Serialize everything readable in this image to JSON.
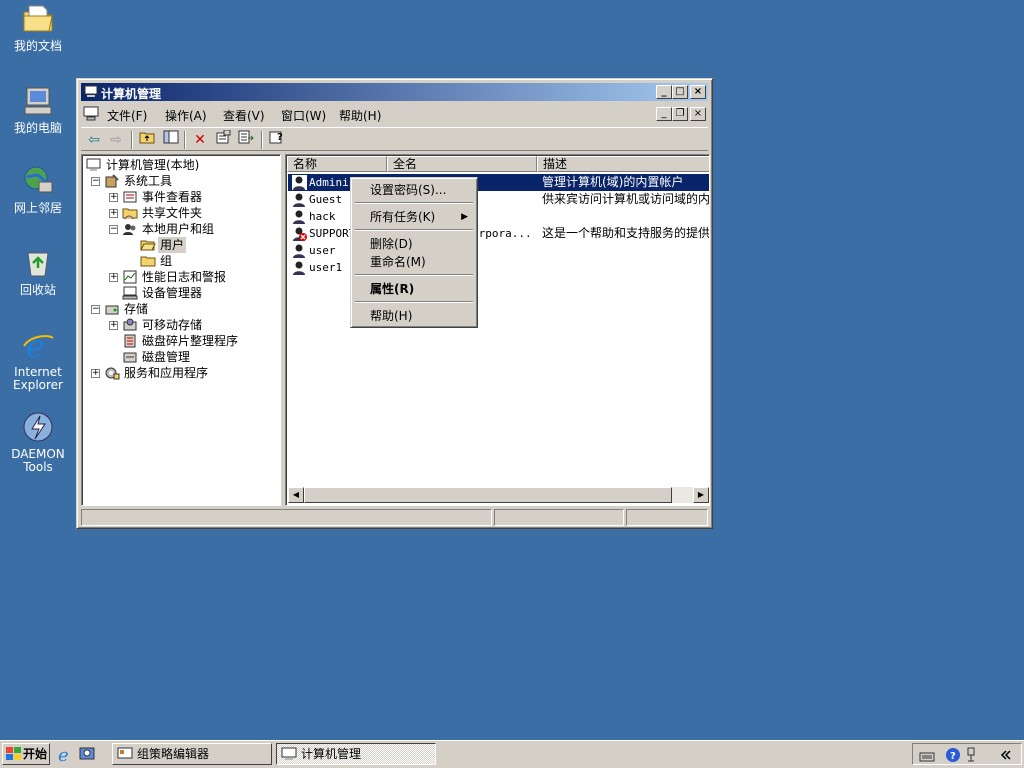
{
  "desktop": {
    "icons": [
      {
        "label": "我的文档"
      },
      {
        "label": "我的电脑"
      },
      {
        "label": "网上邻居"
      },
      {
        "label": "回收站"
      },
      {
        "label_line1": "Internet",
        "label_line2": "Explorer"
      },
      {
        "label": "DAEMON Tools"
      }
    ]
  },
  "window": {
    "title": "计算机管理",
    "caption_buttons": {
      "minimize": "_",
      "maximize": "□",
      "close": "×"
    },
    "menu": [
      "文件(F)",
      "操作(A)",
      "查看(V)",
      "窗口(W)",
      "帮助(H)"
    ],
    "toolbar_icons": [
      "back-icon",
      "forward-icon",
      "up-folder-icon",
      "show-hide-tree-icon",
      "delete-icon",
      "properties-icon",
      "export-list-icon",
      "help-icon"
    ]
  },
  "tree": {
    "nodes": [
      {
        "label": "计算机管理(本地)",
        "expander": ""
      },
      {
        "label": "系统工具",
        "expander": "−"
      },
      {
        "label": "事件查看器",
        "expander": "+"
      },
      {
        "label": "共享文件夹",
        "expander": "+"
      },
      {
        "label": "本地用户和组",
        "expander": "−"
      },
      {
        "label": "用户",
        "expander": ""
      },
      {
        "label": "组",
        "expander": ""
      },
      {
        "label": "性能日志和警报",
        "expander": "+"
      },
      {
        "label": "设备管理器",
        "expander": ""
      },
      {
        "label": "存储",
        "expander": "−"
      },
      {
        "label": "可移动存储",
        "expander": "+"
      },
      {
        "label": "磁盘碎片整理程序",
        "expander": ""
      },
      {
        "label": "磁盘管理",
        "expander": ""
      },
      {
        "label": "服务和应用程序",
        "expander": "+"
      }
    ]
  },
  "list": {
    "columns": [
      "名称",
      "全名",
      "描述"
    ],
    "rows": [
      {
        "name": "Adminis",
        "full": "",
        "desc": "管理计算机(域)的内置帐户"
      },
      {
        "name": "Guest",
        "full": "",
        "desc": "供来宾访问计算机或访问域的内"
      },
      {
        "name": "hack",
        "full": "",
        "desc": ""
      },
      {
        "name": "SUPPORT_",
        "full": "orpora...",
        "desc": "这是一个帮助和支持服务的提供"
      },
      {
        "name": "user",
        "full": "",
        "desc": ""
      },
      {
        "name": "user1",
        "full": "",
        "desc": ""
      }
    ]
  },
  "context_menu": {
    "items": [
      "设置密码(S)...",
      "所有任务(K)",
      "删除(D)",
      "重命名(M)",
      "属性(R)",
      "帮助(H)"
    ]
  },
  "taskbar": {
    "start_label": "开始",
    "tasks": [
      "组策略编辑器",
      "计算机管理"
    ]
  },
  "colors": {
    "desktop": "#3a6ea5",
    "titlebar": "#0a246a",
    "selection": "#0a246a"
  }
}
